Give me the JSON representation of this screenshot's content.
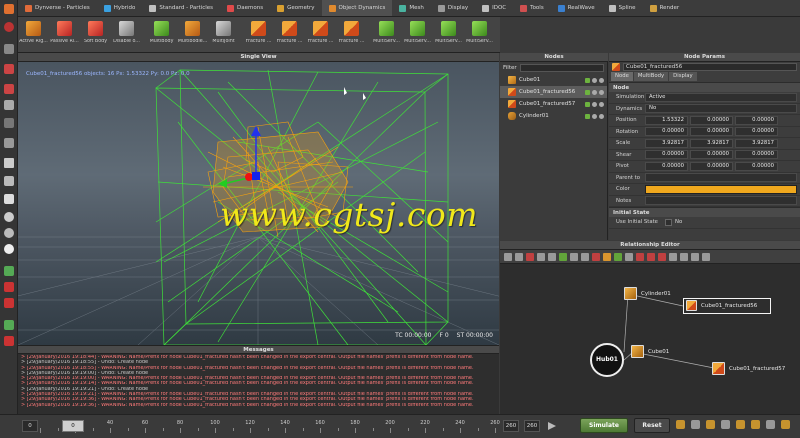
{
  "shelf_tabs": [
    {
      "label": "Dynverse - Particles",
      "color": "#e06b3a",
      "active": false
    },
    {
      "label": "Hybrido",
      "color": "#3aa0e0",
      "active": false
    },
    {
      "label": "Standard - Particles",
      "color": "#c0c0c0",
      "active": false
    },
    {
      "label": "Daemons",
      "color": "#e04a4a",
      "active": false
    },
    {
      "label": "Geometry",
      "color": "#d9a030",
      "active": false
    },
    {
      "label": "Object Dynamics",
      "color": "#e08a2e",
      "active": true
    },
    {
      "label": "Mesh",
      "color": "#4ab3a0",
      "active": false
    },
    {
      "label": "Display",
      "color": "#9a9a9a",
      "active": false
    },
    {
      "label": "IDOC",
      "color": "#c0c0c0",
      "active": false
    },
    {
      "label": "Tools",
      "color": "#d05050",
      "active": false
    },
    {
      "label": "RealWave",
      "color": "#3a80d0",
      "active": false
    },
    {
      "label": "Spline",
      "color": "#c0c0c0",
      "active": false
    },
    {
      "label": "Render",
      "color": "#d0a040",
      "active": false
    }
  ],
  "shelf_tools": [
    {
      "label": "Active Rig...",
      "style": "orange"
    },
    {
      "label": "Passive Ri...",
      "style": "red"
    },
    {
      "label": "Soft Body",
      "style": "red"
    },
    {
      "label": "Disable o...",
      "style": "gray"
    },
    {
      "label": "MultiBody",
      "style": "green"
    },
    {
      "label": "Multibodie...",
      "style": "orange"
    },
    {
      "label": "MultiJoint",
      "style": "gray"
    },
    {
      "label": "Fracture ...",
      "style": "split"
    },
    {
      "label": "Fracture ...",
      "style": "split"
    },
    {
      "label": "Fracture ...",
      "style": "split"
    },
    {
      "label": "Fracture ...",
      "style": "split"
    },
    {
      "label": "MultiServ...",
      "style": "green"
    },
    {
      "label": "MultiServ...",
      "style": "green"
    },
    {
      "label": "MultiServ...",
      "style": "green"
    },
    {
      "label": "MultiServ...",
      "style": "green"
    }
  ],
  "viewport": {
    "title": "Single View",
    "hud_readout": "Cube01_fractured56 objects: 16 Px: 1.53322 Py: 0.0 Pz: 0.0",
    "tc": "TC 00:00:00",
    "frame": "F 0",
    "st": "ST 00:00:00"
  },
  "watermark": "www.cgtsj.com",
  "messages": {
    "title": "Messages",
    "lines": [
      {
        "text": "> [29/January/2016 19:18:44] - WARNING: Name/Prefix for node Cube01_fractured hasn't been changed in the export central. Output file names' prefix is different from node name.",
        "kind": "warn"
      },
      {
        "text": "> [29/January/2016 19:18:55] - Undo: Create node",
        "kind": "info"
      },
      {
        "text": "> [29/January/2016 19:18:55] - WARNING: Name/Prefix for node Cube01_fractured hasn't been changed in the export central. Output file names' prefix is different from node name.",
        "kind": "warn"
      },
      {
        "text": "> [29/January/2016 19:19:00] - Undo: Create node",
        "kind": "info"
      },
      {
        "text": "> [29/January/2016 19:19:00] - WARNING: Name/Prefix for node Cube01_fractured hasn't been changed in the export central. Output file names' prefix is different from node name.",
        "kind": "warn"
      },
      {
        "text": "> [29/January/2016 19:19:14] - WARNING: Name/Prefix for node Cube01_fractured hasn't been changed in the export central. Output file names' prefix is different from node name.",
        "kind": "warn"
      },
      {
        "text": "> [29/January/2016 19:19:21] - Undo: Create node",
        "kind": "info"
      },
      {
        "text": "> [29/January/2016 19:19:21] - WARNING: Name/Prefix for node Cube01_fractured hasn't been changed in the export central. Output file names' prefix is different from node name.",
        "kind": "warn"
      },
      {
        "text": "> [29/January/2016 19:19:36] - WARNING: Name/Prefix for node Cube01_fractured hasn't been changed in the export central. Output file names' prefix is different from node name.",
        "kind": "warn"
      },
      {
        "text": "> [29/January/2016 19:19:36] - WARNING: Name/Prefix for node Cube01_fractured hasn't been changed in the export central. Output file names' prefix is different from node name.",
        "kind": "warn"
      }
    ]
  },
  "timeline": {
    "start": "0",
    "current": "0",
    "ticks": [
      "20",
      "40",
      "60",
      "80",
      "100",
      "120",
      "140",
      "160",
      "180",
      "200",
      "220",
      "240",
      "260"
    ],
    "range_a": "260",
    "range_b": "260",
    "simulate_label": "Simulate",
    "reset_label": "Reset"
  },
  "nodes": {
    "title": "Nodes",
    "filter_label": "Filter",
    "items": [
      {
        "name": "Cube01",
        "icon": "cube",
        "selected": false
      },
      {
        "name": "Cube01_fractured56",
        "icon": "split",
        "selected": true
      },
      {
        "name": "Cube01_fractured57",
        "icon": "split",
        "selected": false
      },
      {
        "name": "Cylinder01",
        "icon": "cyl",
        "selected": false
      }
    ]
  },
  "params": {
    "title": "Node Params",
    "node_name": "Cube01_fractured56",
    "tabs": [
      "Node",
      "MultiBody",
      "Display"
    ],
    "section_node": "Node",
    "simulation_label": "Simulation",
    "simulation_value": "Active",
    "dynamics_label": "Dynamics",
    "dynamics_value": "No",
    "vectors": [
      {
        "label": "Position",
        "x": "1.53322",
        "y": "0.00000",
        "z": "0.00000"
      },
      {
        "label": "Rotation",
        "x": "0.00000",
        "y": "0.00000",
        "z": "0.00000"
      },
      {
        "label": "Scale",
        "x": "3.92817",
        "y": "3.92817",
        "z": "3.92817"
      },
      {
        "label": "Shear",
        "x": "0.00000",
        "y": "0.00000",
        "z": "0.00000"
      },
      {
        "label": "Pivot",
        "x": "0.00000",
        "y": "0.00000",
        "z": "0.00000"
      }
    ],
    "parent_label": "Parent to",
    "color_label": "Color",
    "color_value": "#f0a81e",
    "notes_label": "Notes",
    "section_initial": "Initial State",
    "use_initial_label": "Use Initial State",
    "use_initial_value": "No"
  },
  "relationship": {
    "title": "Relationship Editor",
    "nodes": {
      "cylinder": "Cylinder01",
      "frac56": "Cube01_fractured56",
      "hub": "Hub01",
      "cube": "Cube01",
      "frac57": "Cube01_fractured57"
    }
  }
}
